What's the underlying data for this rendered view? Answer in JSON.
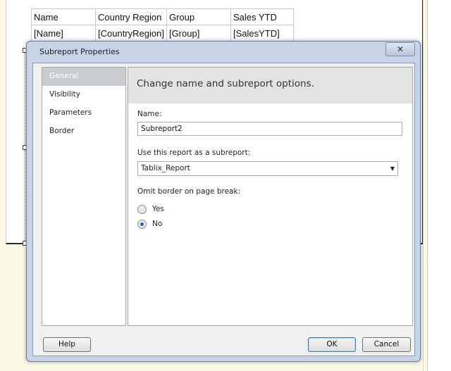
{
  "report_table": {
    "headers": [
      "Name",
      "Country Region",
      "Group",
      "Sales YTD"
    ],
    "fields": [
      "[Name]",
      "[CountryRegion]",
      "[Group]",
      "[SalesYTD]"
    ]
  },
  "dialog": {
    "title": "Subreport Properties",
    "close_glyph": "✕",
    "nav_items": [
      {
        "label": "General",
        "selected": true
      },
      {
        "label": "Visibility",
        "selected": false
      },
      {
        "label": "Parameters",
        "selected": false
      },
      {
        "label": "Border",
        "selected": false
      }
    ],
    "header_text": "Change name and subreport options.",
    "name_label": "Name:",
    "name_value": "Subreport2",
    "subreport_label": "Use this report as a subreport:",
    "subreport_value": "Tablix_Report",
    "omit_border_label": "Omit border on page break:",
    "radio_yes": "Yes",
    "radio_no": "No",
    "selected_option": "No",
    "help_label": "Help",
    "ok_label": "OK",
    "cancel_label": "Cancel"
  },
  "icons": {
    "close": "close-icon",
    "dropdown": "chevron-down-icon"
  },
  "colors": {
    "dialog_frame": "#c6d3e9",
    "nav_selected": "#c9ccd1",
    "radio_checked": "#2a62c8",
    "background": "#fbf8e6"
  }
}
